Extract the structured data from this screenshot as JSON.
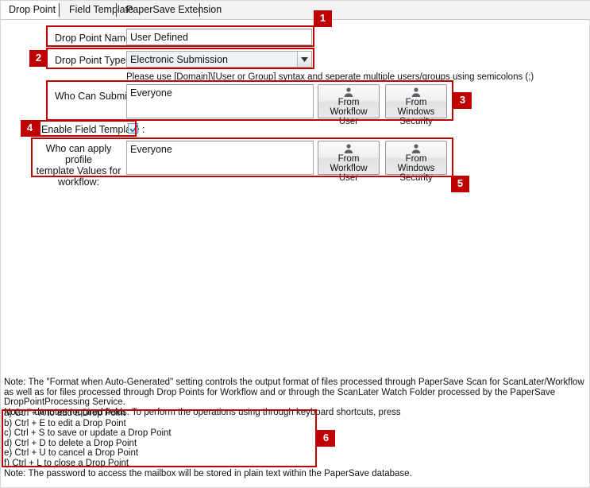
{
  "tabs": [
    {
      "label": "Drop Point",
      "active": true
    },
    {
      "label": "Field Template",
      "active": false
    },
    {
      "label": "PaperSave Extension",
      "active": false
    }
  ],
  "form": {
    "drop_point_name": {
      "label": "Drop Point Name* :",
      "value": "User Defined",
      "placeholder": ""
    },
    "drop_point_type": {
      "label": "Drop Point Type* :",
      "value": "Electronic Submission",
      "options": [
        "Electronic Submission"
      ]
    },
    "hint": "Please use [Domain]\\[User or Group] syntax and seperate multiple users/groups using semicolons (;)",
    "who_can_submit": {
      "label": "Who Can Submit :",
      "value": "Everyone",
      "placeholder": ""
    },
    "enable_field_template": {
      "label": "Enable Field Template :",
      "checked": true
    },
    "who_can_apply": {
      "label": "Who can apply profile template Values for workflow:",
      "label_line1": "Who can apply profile",
      "label_line2": "template Values for",
      "label_line3": "workflow:",
      "value": "Everyone",
      "placeholder": ""
    },
    "buttons": {
      "from_workflow_user": {
        "line1": "From Workflow",
        "line2": "User",
        "icon": "user-icon"
      },
      "from_windows_security": {
        "line1": "From Windows",
        "line2": "Security",
        "icon": "user-icon"
      }
    }
  },
  "notes": {
    "note1": "Note: The \"Format when Auto-Generated\" setting controls the output format of files processed through PaperSave Scan for ScanLater/Workflow as well as for files processed through Drop Points for Workflow and or through the ScanLater Watch Folder processed by the PaperSave DropPointProcessing Service.",
    "note2": "Note: * denotes required fields. To perform the operations using through keyboard shortcuts, press",
    "shortcuts": [
      "a) Ctrl + A to add a Drop Point",
      "b) Ctrl + E to edit a Drop Point",
      "c) Ctrl + S to save or update a Drop Point",
      "d) Ctrl + D to delete a Drop Point",
      "e) Ctrl + U to cancel a Drop Point",
      "f) Ctrl + L to close a Drop Point"
    ],
    "note3": "Note: The password to access the mailbox will be stored in plain text within the PaperSave database."
  },
  "annotations": {
    "badges": [
      {
        "number": "1"
      },
      {
        "number": "2"
      },
      {
        "number": "3"
      },
      {
        "number": "4"
      },
      {
        "number": "5"
      },
      {
        "number": "6"
      }
    ],
    "accent_color": "#c00000"
  }
}
